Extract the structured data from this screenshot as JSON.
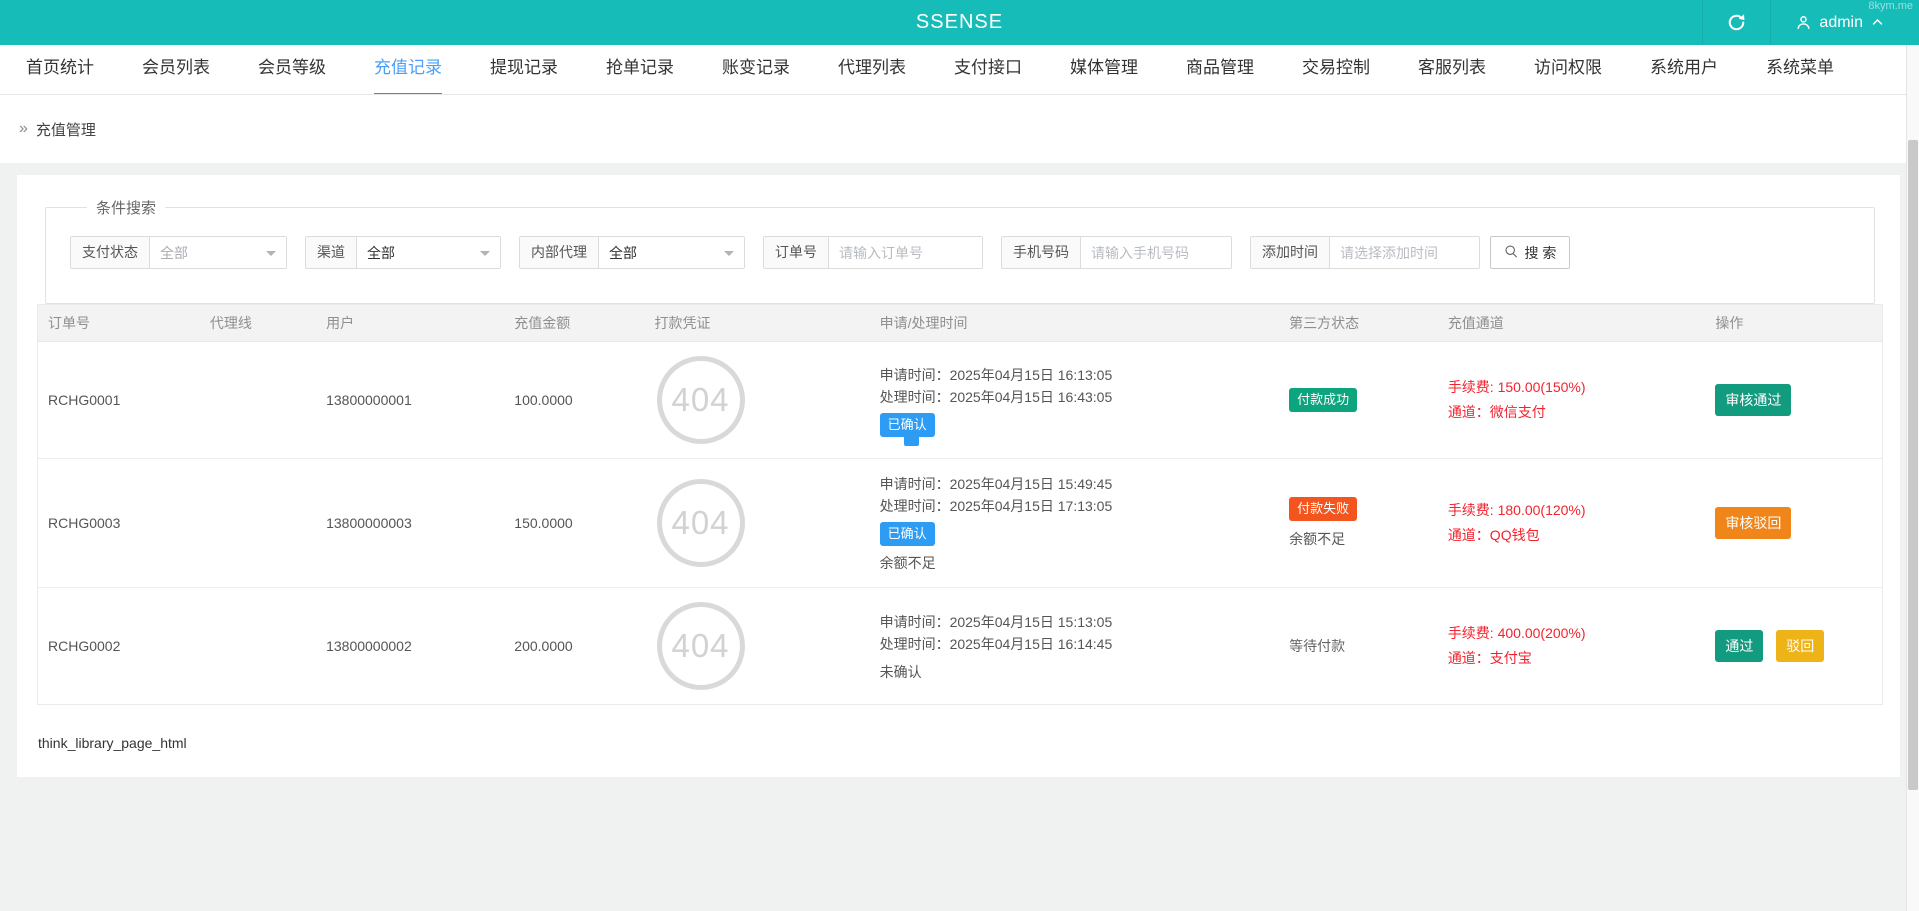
{
  "header": {
    "title": "SSENSE",
    "watermark": "8kym.me",
    "user": "admin"
  },
  "nav": {
    "tabs": [
      "首页统计",
      "会员列表",
      "会员等级",
      "充值记录",
      "提现记录",
      "抢单记录",
      "账变记录",
      "代理列表",
      "支付接口",
      "媒体管理",
      "商品管理",
      "交易控制",
      "客服列表",
      "访问权限",
      "系统用户",
      "系统菜单"
    ],
    "active_tab": "充值记录"
  },
  "breadcrumb": {
    "label": "充值管理"
  },
  "search": {
    "legend": "条件搜索",
    "selects": [
      {
        "label": "支付状态",
        "value": "全部"
      },
      {
        "label": "渠道",
        "value": "全部"
      },
      {
        "label": "内部代理",
        "value": "全部"
      }
    ],
    "inputs": [
      {
        "label": "订单号",
        "placeholder": "请输入订单号"
      },
      {
        "label": "手机号码",
        "placeholder": "请输入手机号码"
      },
      {
        "label": "添加时间",
        "placeholder": "请选择添加时间"
      }
    ],
    "search_button": "搜 索"
  },
  "table": {
    "columns": [
      "订单号",
      "代理线",
      "用户",
      "充值金额",
      "打款凭证",
      "申请/处理时间",
      "第三方状态",
      "充值通道",
      "操作"
    ],
    "rows": [
      {
        "order_no": "RCHG0001",
        "agent_line": "",
        "user": "13800000001",
        "amount": "100.0000",
        "image_placeholder": "404",
        "apply_time": "申请时间：2025年04月15日 16:13:05",
        "process_time": "处理时间：2025年04月15日 16:43:05",
        "confirm_badge": "已确认",
        "third_badge": "付款成功",
        "fee": "手续费: 150.00(150%)",
        "channel": "通道：微信支付",
        "actions": [
          "审核通过"
        ]
      },
      {
        "order_no": "RCHG0003",
        "agent_line": "",
        "user": "13800000003",
        "amount": "150.0000",
        "image_placeholder": "404",
        "apply_time": "申请时间：2025年04月15日 15:49:45",
        "process_time": "处理时间：2025年04月15日 17:13:05",
        "confirm_badge": "已确认",
        "confirm_note": "余额不足",
        "third_badge": "付款失败",
        "third_note": "余额不足",
        "fee": "手续费: 180.00(120%)",
        "channel": "通道：QQ钱包",
        "actions": [
          "审核驳回"
        ]
      },
      {
        "order_no": "RCHG0002",
        "agent_line": "",
        "user": "13800000002",
        "amount": "200.0000",
        "image_placeholder": "404",
        "apply_time": "申请时间：2025年04月15日 15:13:05",
        "process_time": "处理时间：2025年04月15日 16:14:45",
        "confirm_note": "未确认",
        "third_text": "等待付款",
        "fee": "手续费: 400.00(200%)",
        "channel": "通道：支付宝",
        "actions": [
          "通过",
          "驳回"
        ]
      }
    ]
  },
  "footer": {
    "debug_text": "think_library_page_html"
  },
  "colors": {
    "header_bg": "#16bcb8",
    "active_tab": "#4a9ff8",
    "active_tab_underline": "#3a8ee6",
    "danger_text": "#f5222d",
    "badge_confirm_blue": "#2d9cf5",
    "badge_success_green": "#0ca57d",
    "badge_fail_red": "#f4541d",
    "button_teal": "#129b7f",
    "button_orange": "#f08519",
    "button_yellow": "#eeb317"
  }
}
